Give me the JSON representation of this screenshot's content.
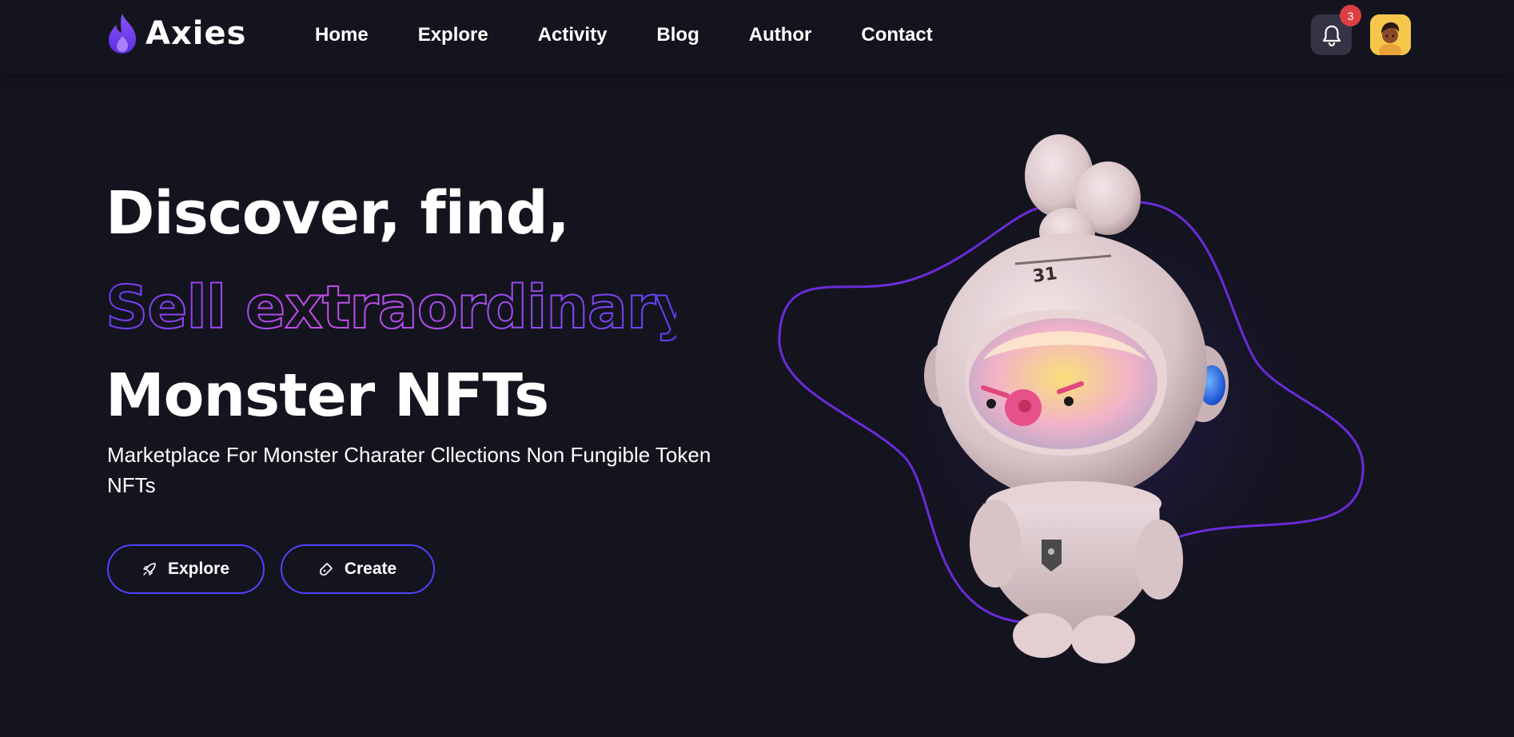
{
  "brand": {
    "name": "Axies"
  },
  "nav": {
    "items": [
      {
        "label": "Home"
      },
      {
        "label": "Explore"
      },
      {
        "label": "Activity"
      },
      {
        "label": "Blog"
      },
      {
        "label": "Author"
      },
      {
        "label": "Contact"
      }
    ]
  },
  "header": {
    "notification_count": "3",
    "icons": {
      "notifications": "bell-icon",
      "profile": "avatar"
    }
  },
  "hero": {
    "line1": "Discover, find,",
    "line2": "Sell extraordinary",
    "line3": "Monster NFTs",
    "subtitle": "Marketplace For Monster Charater Cllections Non Fungible Token NFTs",
    "buttons": {
      "explore_label": "Explore",
      "explore_icon": "rocket-icon",
      "create_label": "Create",
      "create_icon": "note-icon"
    },
    "artwork": {
      "subject": "astronaut-monster-figure",
      "number": "31"
    }
  },
  "colors": {
    "background": "#14141f",
    "accent_purple": "#5142fc",
    "gradient_start": "#6a3df7",
    "gradient_end": "#e250e5",
    "badge_red": "#dd3e44",
    "bell_bg": "#343444",
    "avatar_bg": "#f5c64a"
  }
}
